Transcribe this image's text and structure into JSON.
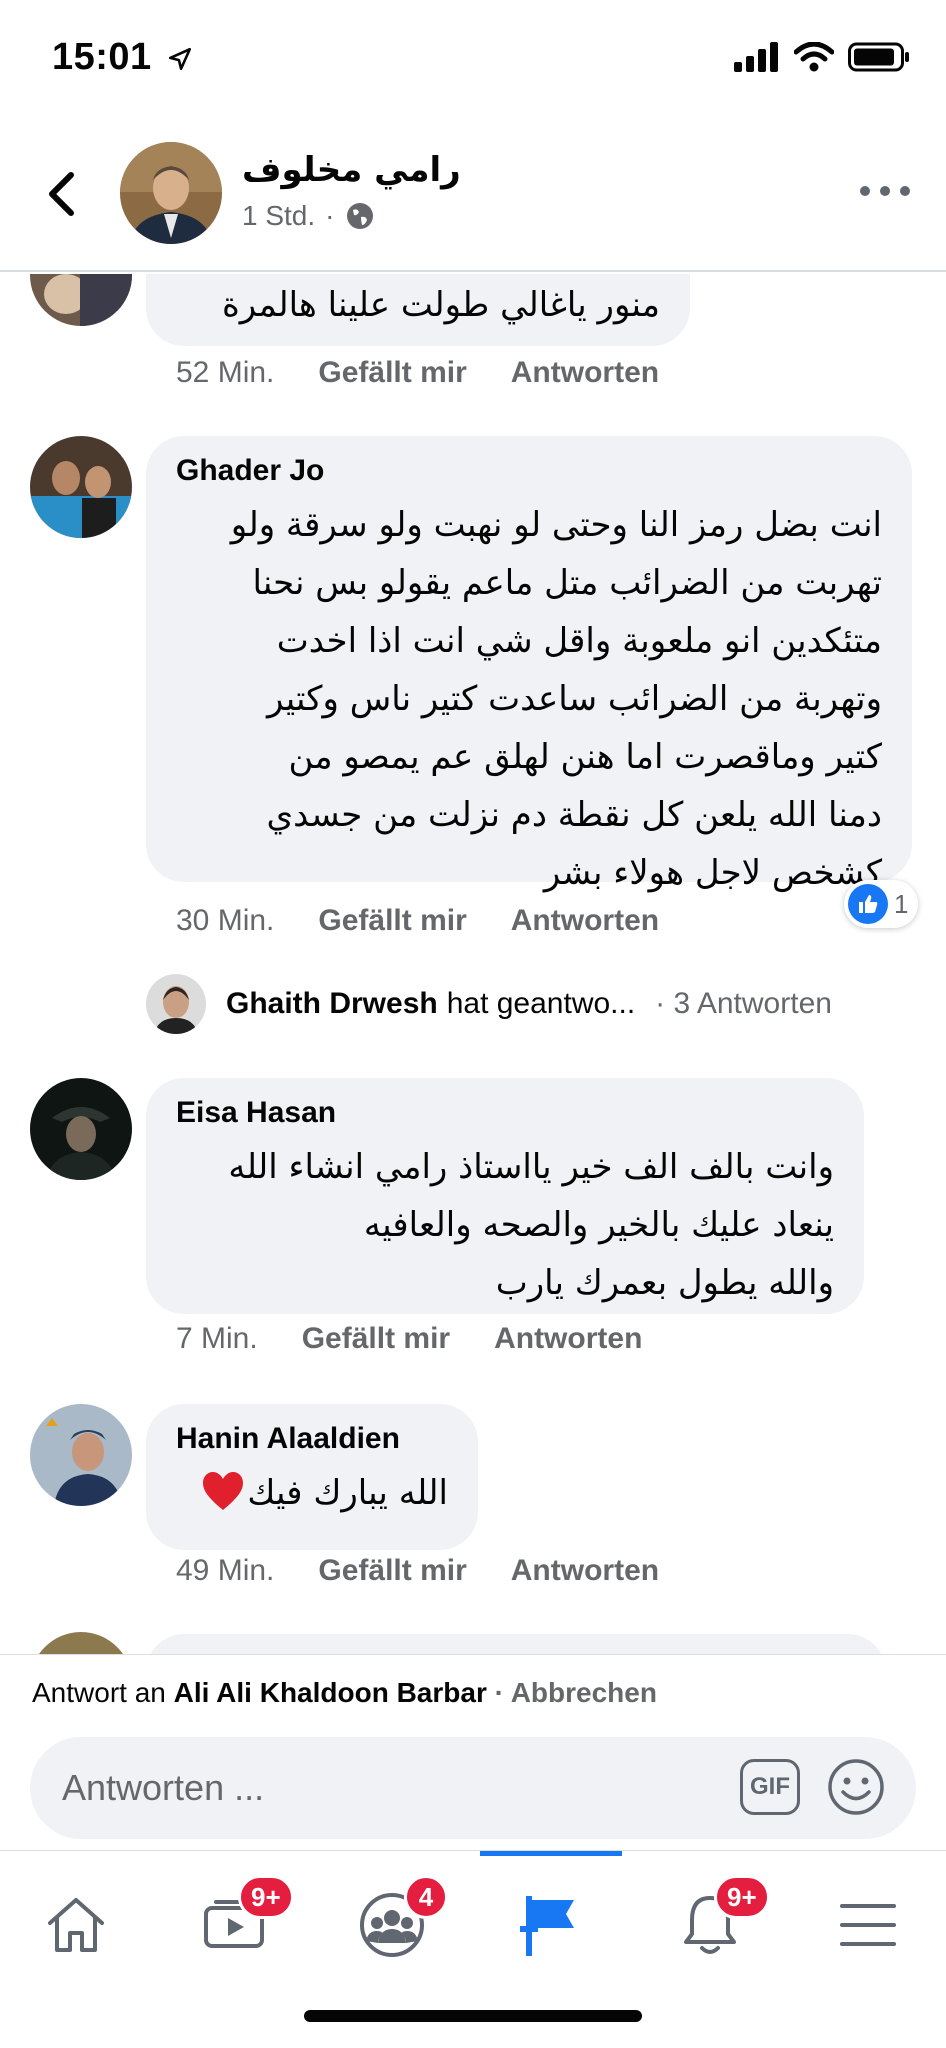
{
  "status_bar": {
    "time": "15:01"
  },
  "header": {
    "name": "رامي مخلوف",
    "meta": "1 Std."
  },
  "comments": [
    {
      "author": "",
      "text_lines": [
        "منور ياغالي طولت علينا هالمرة"
      ],
      "time": "52 Min.",
      "like_label": "Gefällt mir",
      "reply_label": "Antworten"
    },
    {
      "author": "Ghader Jo",
      "text_lines": [
        "انت بضل رمز النا وحتى لو نهبت ولو سرقة ولو",
        "تهربت من الضرائب متل ماعم يقولو بس نحنا",
        "متئكدين انو ملعوبة واقل شي انت اذا اخدت",
        "وتهربة من الضرائب ساعدت كتير ناس وكتير",
        "كتير وماقصرت اما هنن لهلق عم يمصو من",
        "دمنا الله يلعن كل نقطة دم نزلت من جسدي",
        "كشخص لاجل هولاء بشر"
      ],
      "time": "30 Min.",
      "like_label": "Gefällt mir",
      "reply_label": "Antworten",
      "reaction_count": "1",
      "replies": {
        "name": "Ghaith Drwesh",
        "text": "hat geantwo...",
        "count": "· 3 Antworten"
      }
    },
    {
      "author": "Eisa Hasan",
      "text_lines": [
        "وانت بالف الف خير يااستاذ رامي انشاء الله",
        "ينعاد عليك بالخير والصحه والعافيه",
        "والله يطول بعمرك يارب"
      ],
      "time": "7 Min.",
      "like_label": "Gefällt mir",
      "reply_label": "Antworten"
    },
    {
      "author": "Hanin Alaaldien",
      "text_lines": [
        "الله يبارك فيك"
      ],
      "time": "49 Min.",
      "like_label": "Gefällt mir",
      "reply_label": "Antworten"
    }
  ],
  "reply_bar": {
    "prefix": "Antwort an",
    "target": "Ali Ali Khaldoon Barbar",
    "cancel": "· Abbrechen",
    "placeholder": "Antworten ...",
    "gif_label": "GIF"
  },
  "nav": {
    "badges": {
      "watch": "9+",
      "groups": "4",
      "notifications": "9+"
    },
    "active": "pages"
  },
  "colors": {
    "accent": "#1877f2",
    "badge": "#e41e3f",
    "bubble": "#f0f2f5",
    "secondary_text": "#65676b"
  }
}
